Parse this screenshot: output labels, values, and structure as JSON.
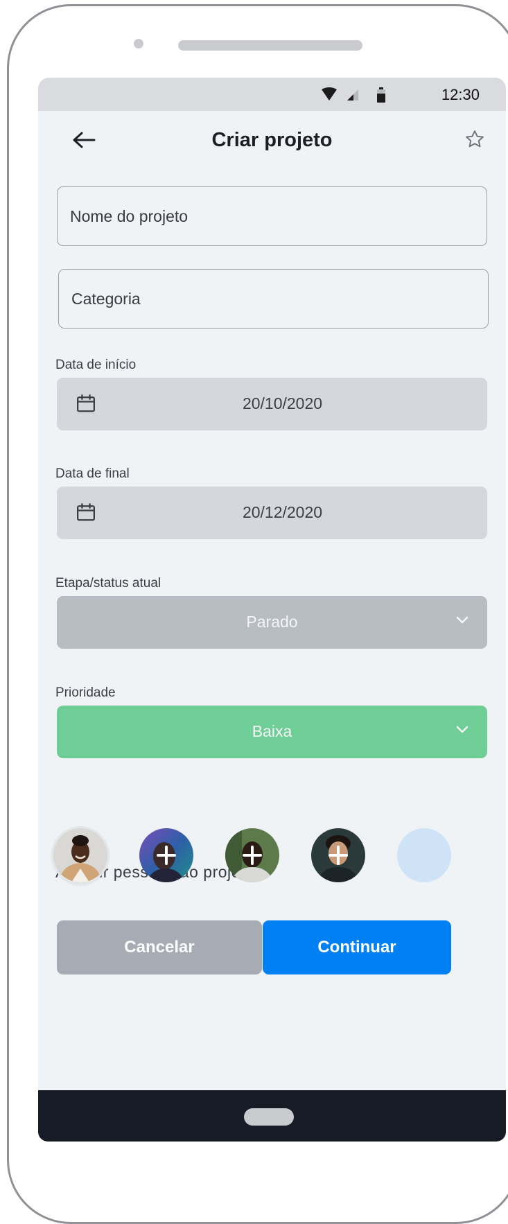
{
  "status_bar": {
    "time": "12:30"
  },
  "header": {
    "title": "Criar projeto"
  },
  "form": {
    "name_placeholder": "Nome do projeto",
    "category_placeholder": "Categoria",
    "start_date_label": "Data de início",
    "start_date_value": "20/10/2020",
    "end_date_label": "Data de final",
    "end_date_value": "20/12/2020",
    "status_label": "Etapa/status atual",
    "status_value": "Parado",
    "priority_label": "Prioridade",
    "priority_value": "Baixa"
  },
  "assign": {
    "label": "Atribuir pessoas ao projeto"
  },
  "actions": {
    "cancel_label": "Cancelar",
    "continue_label": "Continuar"
  },
  "colors": {
    "primary": "#0080f2",
    "priority_low": "#6fce95",
    "status_select": "#b8bdc4",
    "cancel": "#a6abb4"
  }
}
